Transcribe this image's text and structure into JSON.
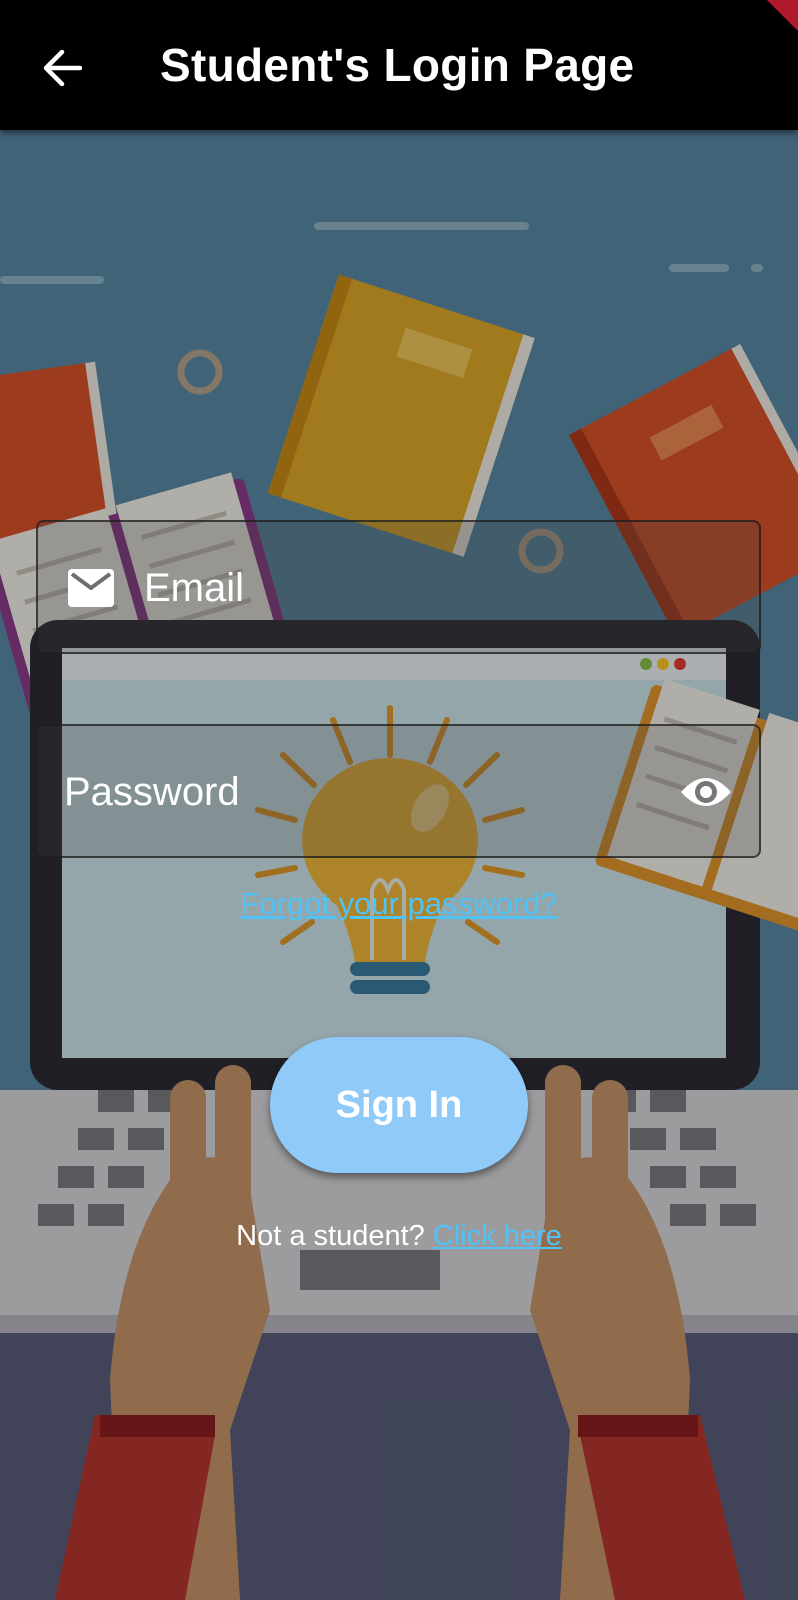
{
  "appbar": {
    "title": "Student's Login Page",
    "back_icon": "arrow-left-icon"
  },
  "form": {
    "email_label": "Email",
    "email_icon": "mail-icon",
    "password_label": "Password",
    "password_toggle_icon": "eye-icon",
    "forgot_link": "Forgot your password?",
    "signin_label": "Sign In",
    "not_student_text": "Not a student?",
    "click_here_link": "Click here"
  },
  "colors": {
    "appbar_bg": "#000000",
    "link": "#4fc3f7",
    "signin_button": "#90caf9",
    "background_sky": "#5b8aa6"
  }
}
